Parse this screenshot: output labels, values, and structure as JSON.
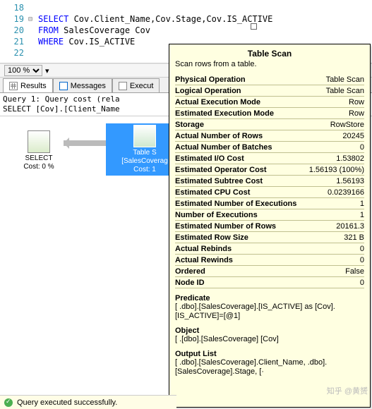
{
  "editor": {
    "lines": [
      {
        "num": "18",
        "fold": "",
        "code": ""
      },
      {
        "num": "19",
        "fold": "⊟",
        "code_html": "<span class='kw'>SELECT</span> Cov.Client_Name,Cov.Stage,Cov.IS_ACTIVE"
      },
      {
        "num": "20",
        "fold": "",
        "code_html": "<span class='kw'>FROM</span> SalesCoverage Cov"
      },
      {
        "num": "21",
        "fold": "",
        "code_html": "<span class='kw'>WHERE</span> Cov.IS_ACTIVE"
      },
      {
        "num": "22",
        "fold": "",
        "code": ""
      }
    ]
  },
  "zoom": {
    "value": "100 %"
  },
  "tabs": [
    {
      "id": "results",
      "label": "Results"
    },
    {
      "id": "messages",
      "label": "Messages"
    },
    {
      "id": "execplan",
      "label": "Execut"
    }
  ],
  "queryHeader": {
    "line1": "Query 1: Query cost (rela",
    "line2": "SELECT [Cov].[Client_Name"
  },
  "plan": {
    "nodeA": {
      "title": "SELECT",
      "cost": "Cost: 0 %"
    },
    "nodeB": {
      "l1": "Table S",
      "l2": "[SalesCoverag",
      "l3": "Cost: 1"
    }
  },
  "tooltip": {
    "title": "Table Scan",
    "subtitle": "Scan rows from a table.",
    "props": [
      {
        "k": "Physical Operation",
        "v": "Table Scan"
      },
      {
        "k": "Logical Operation",
        "v": "Table Scan"
      },
      {
        "k": "Actual Execution Mode",
        "v": "Row"
      },
      {
        "k": "Estimated Execution Mode",
        "v": "Row"
      },
      {
        "k": "Storage",
        "v": "RowStore"
      },
      {
        "k": "Actual Number of Rows",
        "v": "20245"
      },
      {
        "k": "Actual Number of Batches",
        "v": "0"
      },
      {
        "k": "Estimated I/O Cost",
        "v": "1.53802"
      },
      {
        "k": "Estimated Operator Cost",
        "v": "1.56193 (100%)"
      },
      {
        "k": "Estimated Subtree Cost",
        "v": "1.56193"
      },
      {
        "k": "Estimated CPU Cost",
        "v": "0.0239166"
      },
      {
        "k": "Estimated Number of Executions",
        "v": "1"
      },
      {
        "k": "Number of Executions",
        "v": "1"
      },
      {
        "k": "Estimated Number of Rows",
        "v": "20161.3"
      },
      {
        "k": "Estimated Row Size",
        "v": "321 B"
      },
      {
        "k": "Actual Rebinds",
        "v": "0"
      },
      {
        "k": "Actual Rewinds",
        "v": "0"
      },
      {
        "k": "Ordered",
        "v": "False"
      },
      {
        "k": "Node ID",
        "v": "0"
      }
    ],
    "predicate": {
      "label": "Predicate",
      "text": "[        .dbo].[SalesCoverage].[IS_ACTIVE] as [Cov].[IS_ACTIVE]=[@1]"
    },
    "object": {
      "label": "Object",
      "text": "[        .[dbo].[SalesCoverage] [Cov]"
    },
    "output": {
      "label": "Output List",
      "text": "[        .dbo].[SalesCoverage].Client_Name,        .dbo].[SalesCoverage].Stage, [·"
    }
  },
  "status": {
    "text": "Query executed successfully."
  },
  "watermark": "知乎 @黄赟"
}
